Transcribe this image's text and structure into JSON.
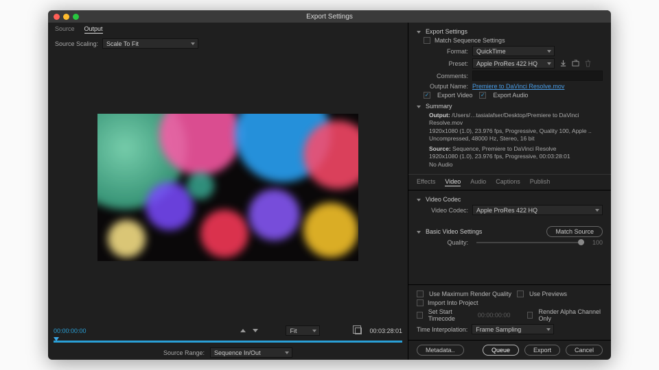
{
  "title": "Export Settings",
  "leftTabs": {
    "source": "Source",
    "output": "Output"
  },
  "sourceScaling": {
    "label": "Source Scaling:",
    "value": "Scale To Fit"
  },
  "transport": {
    "tcStart": "00:00:00:00",
    "fit": "Fit",
    "tcEnd": "00:03:28:01"
  },
  "sourceRange": {
    "label": "Source Range:",
    "value": "Sequence In/Out"
  },
  "export": {
    "header": "Export Settings",
    "matchSeq": "Match Sequence Settings",
    "formatLbl": "Format:",
    "format": "QuickTime",
    "presetLbl": "Preset:",
    "preset": "Apple ProRes 422 HQ",
    "commentsLbl": "Comments:",
    "outputNameLbl": "Output Name:",
    "outputName": "Premiere to DaVinci Resolve.mov",
    "expVideo": "Export Video",
    "expAudio": "Export Audio",
    "summaryHdr": "Summary",
    "outLbl": "Output:",
    "outPath": "/Users/…tasialafser/Desktop/Premiere to DaVinci Resolve.mov",
    "outL1": "1920x1080 (1.0), 23.976 fps, Progressive, Quality 100, Apple ..",
    "outL2": "Uncompressed, 48000 Hz, Stereo, 16 bit",
    "srcLbl": "Source:",
    "srcPath": "Sequence, Premiere to DaVinci Resolve",
    "srcL1": "1920x1080 (1.0), 23.976 fps, Progressive, 00:03:28:01",
    "srcL2": "No Audio"
  },
  "midTabs": {
    "effects": "Effects",
    "video": "Video",
    "audio": "Audio",
    "captions": "Captions",
    "publish": "Publish"
  },
  "videoCodec": {
    "header": "Video Codec",
    "label": "Video Codec:",
    "value": "Apple ProRes 422 HQ"
  },
  "basic": {
    "header": "Basic Video Settings",
    "matchSource": "Match Source",
    "qualityLbl": "Quality:",
    "qualityVal": "100"
  },
  "bottom": {
    "useMax": "Use Maximum Render Quality",
    "usePrev": "Use Previews",
    "importProj": "Import Into Project",
    "setStart": "Set Start Timecode",
    "startTc": "00:00:00:00",
    "renderAlpha": "Render Alpha Channel Only",
    "timeInterpLbl": "Time Interpolation:",
    "timeInterp": "Frame Sampling"
  },
  "buttons": {
    "metadata": "Metadata..",
    "queue": "Queue",
    "export": "Export",
    "cancel": "Cancel"
  }
}
